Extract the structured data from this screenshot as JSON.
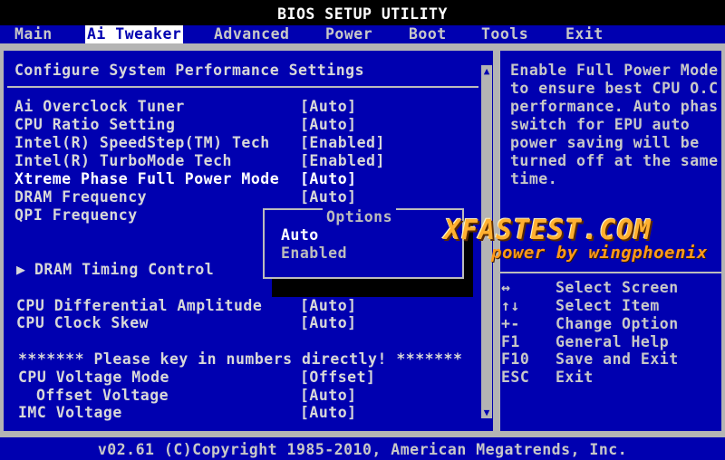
{
  "title": "BIOS SETUP UTILITY",
  "menu": [
    "Main",
    "Ai Tweaker",
    "Advanced",
    "Power",
    "Boot",
    "Tools",
    "Exit"
  ],
  "selected_menu": "Ai Tweaker",
  "section_title": "Configure System Performance Settings",
  "settings": [
    {
      "label": "Ai Overclock Tuner",
      "value": "[Auto]"
    },
    {
      "label": "CPU Ratio Setting",
      "value": "[Auto]"
    },
    {
      "label": "Intel(R) SpeedStep(TM) Tech",
      "value": "[Enabled]"
    },
    {
      "label": "Intel(R) TurboMode Tech",
      "value": "[Enabled]"
    },
    {
      "label": "Xtreme Phase Full Power Mode",
      "value": "[Auto]",
      "highlighted": true
    },
    {
      "label": "DRAM Frequency",
      "value": "[Auto]"
    },
    {
      "label": "QPI Frequency",
      "value": ""
    }
  ],
  "submenu": {
    "arrow": "▶",
    "label": "DRAM Timing Control"
  },
  "settings2": [
    {
      "label": "CPU Differential Amplitude",
      "value": "[Auto]"
    },
    {
      "label": "CPU Clock Skew",
      "value": "[Auto]"
    }
  ],
  "numbers_note": "******* Please key in numbers directly! *******",
  "settings3": [
    {
      "label": "CPU Voltage Mode",
      "value": "[Offset]"
    },
    {
      "label": "Offset Voltage",
      "value": "[Auto]"
    },
    {
      "label": "IMC Voltage",
      "value": "[Auto]"
    }
  ],
  "popup": {
    "title": "Options",
    "options": [
      "Auto",
      "Enabled"
    ],
    "selected": "Auto"
  },
  "help_text": [
    "Enable Full Power Mode",
    "to ensure best CPU O.C",
    "performance. Auto phas",
    "switch for EPU auto",
    "power saving will be",
    "turned off at the same",
    "time."
  ],
  "watermark": {
    "brand": "XFASTEST.COM",
    "sub": "power by wingphoenix"
  },
  "keys": [
    {
      "key": "↔",
      "action": "Select Screen"
    },
    {
      "key": "↑↓",
      "action": "Select Item"
    },
    {
      "key": "+-",
      "action": "Change Option"
    },
    {
      "key": "F1",
      "action": "General Help"
    },
    {
      "key": "F10",
      "action": "Save and Exit"
    },
    {
      "key": "ESC",
      "action": "Exit"
    }
  ],
  "footer": "v02.61 (C)Copyright 1985-2010, American Megatrends, Inc.",
  "colors": {
    "background": "#0000b0",
    "frame": "#b4b4b4",
    "text": "#d8d8d8",
    "highlight": "#ffffff",
    "title_bar": "#000000"
  }
}
